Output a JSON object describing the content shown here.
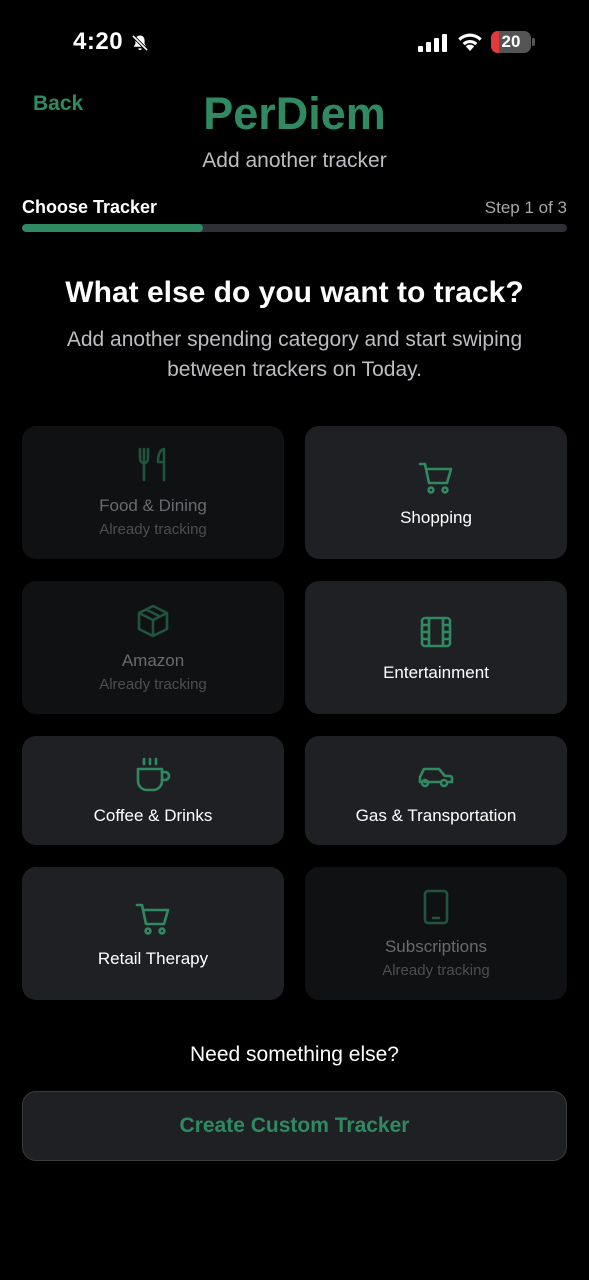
{
  "status_bar": {
    "time": "4:20",
    "battery_level": "20",
    "battery_fraction": 0.2
  },
  "header": {
    "back_label": "Back",
    "title": "PerDiem",
    "subtitle": "Add another tracker"
  },
  "steps": {
    "label": "Choose Tracker",
    "count": "Step 1 of 3",
    "progress": 0.333
  },
  "main": {
    "question": "What else do you want to track?",
    "description": "Add another spending category and start swiping between trackers on Today."
  },
  "trackers": [
    {
      "label": "Food & Dining",
      "note": "Already tracking",
      "icon": "fork-knife-icon",
      "disabled": true
    },
    {
      "label": "Shopping",
      "note": "",
      "icon": "cart-icon",
      "disabled": false
    },
    {
      "label": "Amazon",
      "note": "Already tracking",
      "icon": "box-icon",
      "disabled": true
    },
    {
      "label": "Entertainment",
      "note": "",
      "icon": "film-icon",
      "disabled": false
    },
    {
      "label": "Coffee & Drinks",
      "note": "",
      "icon": "coffee-cup-icon",
      "disabled": false
    },
    {
      "label": "Gas & Transportation",
      "note": "",
      "icon": "car-icon",
      "disabled": false
    },
    {
      "label": "Retail Therapy",
      "note": "",
      "icon": "cart-icon",
      "disabled": false
    },
    {
      "label": "Subscriptions",
      "note": "Already tracking",
      "icon": "phone-icon",
      "disabled": true
    }
  ],
  "footer": {
    "prompt": "Need something else?",
    "custom_button_label": "Create Custom Tracker"
  },
  "colors": {
    "accent": "#2f8a62",
    "background": "#000000",
    "card": "#1f2023",
    "card_disabled": "#101112"
  }
}
